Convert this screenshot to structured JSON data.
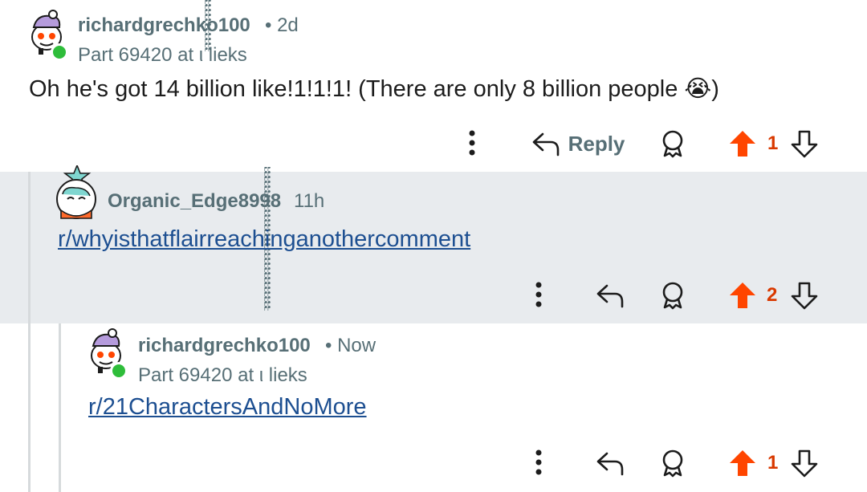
{
  "comments": [
    {
      "username": "richardgrechko100",
      "meta": "• 2d",
      "flair": "Part 69420 at ι lieks",
      "body": "Oh he's got 14 billion like!1!1!1! (There are only 8 billion people 😭)",
      "reply_label": "Reply",
      "votes": "1"
    },
    {
      "username": "Organic_Edge8998",
      "meta": "11h",
      "link": "r/whyisthatflairreachinganothercomment",
      "votes": "2"
    },
    {
      "username": "richardgrechko100",
      "meta": "• Now",
      "flair": "Part 69420 at ι lieks",
      "link": "r/21CharactersAndNoMore",
      "votes": "1"
    }
  ],
  "glitch_text": "ᖰᖰᖰᖰᖰᖰᖰᖰᖰᖰᖰᖰᖰᖰᖰᖰᖰᖰᖰᖰᖰᖰᖰᖰᖰᖰᖰᖰᖰᖰᖰᖰᖰᖰᖰᖰᖰᖰᖰᖰᖰᖰᖰᖰᖰᖰᖰᖰᖰᖰᖰᖰᖰᖰᖰᖰᖰᖰᖰᖰ",
  "colors": {
    "upvote_active": "#ff4500",
    "vote_count": "#d93900",
    "username": "#576f76",
    "link": "#1d4f91",
    "highlight_bg": "#e8ebee",
    "online": "#2ebd3a"
  },
  "icons": [
    "more-vertical-icon",
    "reply-icon",
    "award-icon",
    "upvote-icon",
    "downvote-icon"
  ]
}
